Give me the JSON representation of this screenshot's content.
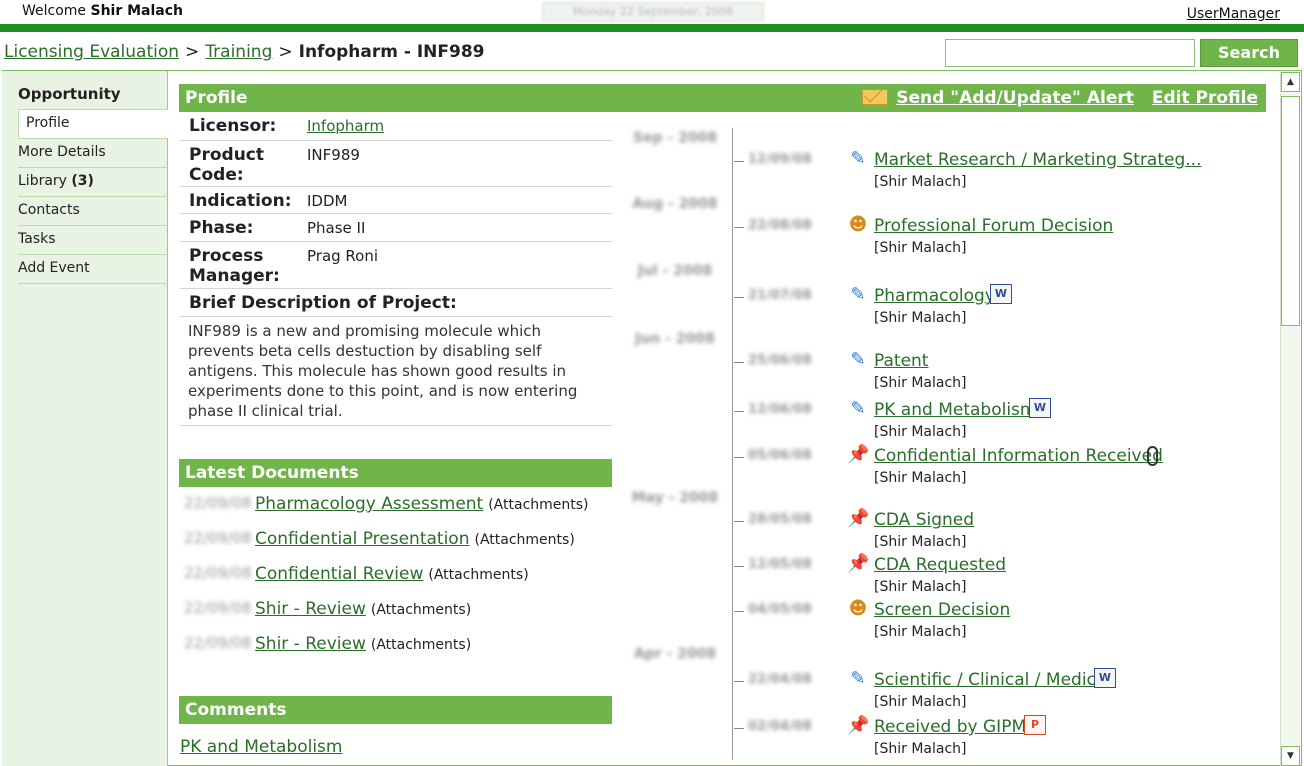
{
  "header": {
    "welcome_prefix": "Welcome",
    "user_name": "Shir Malach",
    "date_text": "Monday 22 September, 2008",
    "user_manager_link": "UserManager"
  },
  "breadcrumb": {
    "items": [
      "Licensing Evaluation",
      "Training"
    ],
    "separator": ">",
    "current": "Infopharm - INF989"
  },
  "search": {
    "value": "",
    "button_label": "Search"
  },
  "sidebar": {
    "heading": "Opportunity",
    "items": [
      {
        "label": "Profile",
        "count": ""
      },
      {
        "label": "More Details",
        "count": ""
      },
      {
        "label": "Library",
        "count": "(3)"
      },
      {
        "label": "Contacts",
        "count": ""
      },
      {
        "label": "Tasks",
        "count": ""
      },
      {
        "label": "Add Event",
        "count": ""
      }
    ]
  },
  "profile": {
    "title": "Profile",
    "send_alert_label": "Send \"Add/Update\" Alert",
    "edit_label": "Edit Profile",
    "fields": [
      {
        "label": "Licensor:",
        "value": "Infopharm"
      },
      {
        "label": "Product Code:",
        "value": "INF989"
      },
      {
        "label": "Indication:",
        "value": "IDDM"
      },
      {
        "label": "Phase:",
        "value": "Phase II"
      },
      {
        "label": "Process Manager:",
        "value": "Prag Roni"
      }
    ],
    "brief_label": "Brief Description of Project:",
    "description": "INF989 is a new and promising molecule which prevents beta cells destuction by disabling self antigens. This molecule has shown good results in experiments done to this point, and is now entering phase II clinical trial."
  },
  "latest_documents": {
    "title": "Latest Documents",
    "items": [
      {
        "date": "22/09/08",
        "title": "Pharmacology Assessment",
        "note": "(Attachments)"
      },
      {
        "date": "22/09/08",
        "title": "Confidential Presentation",
        "note": "(Attachments)"
      },
      {
        "date": "22/09/08",
        "title": "Confidential Review",
        "note": "(Attachments)"
      },
      {
        "date": "22/09/08",
        "title": "Shir - Review",
        "note": "(Attachments)"
      },
      {
        "date": "22/09/08",
        "title": "Shir - Review",
        "note": "(Attachments)"
      }
    ]
  },
  "comments": {
    "title": "Comments",
    "first_link": "PK and Metabolism"
  },
  "timeline": {
    "months": [
      "Sep - 2008",
      "Aug - 2008",
      "Jul - 2008",
      "Jun - 2008",
      "May - 2008",
      "Apr - 2008"
    ],
    "events": [
      {
        "date": "12/09/08",
        "icon": "pencil-icon",
        "title": "Market Research / Marketing Strateg...",
        "author": "[Shir Malach]",
        "attachment": ""
      },
      {
        "date": "22/08/08",
        "icon": "people-icon",
        "title": "Professional Forum Decision",
        "author": "[Shir Malach]",
        "attachment": ""
      },
      {
        "date": "21/07/08",
        "icon": "pencil-icon",
        "title": "Pharmacology",
        "author": "[Shir Malach]",
        "attachment": "word-doc-icon"
      },
      {
        "date": "25/06/08",
        "icon": "pencil-icon",
        "title": "Patent",
        "author": "[Shir Malach]",
        "attachment": ""
      },
      {
        "date": "12/06/08",
        "icon": "pencil-icon",
        "title": "PK and Metabolism",
        "author": "[Shir Malach]",
        "attachment": "word-doc-icon"
      },
      {
        "date": "05/06/08",
        "icon": "pin-icon",
        "title": "Confidential Information Received",
        "author": "[Shir Malach]",
        "attachment": "paperclip-icon"
      },
      {
        "date": "28/05/08",
        "icon": "pin-icon",
        "title": "CDA Signed",
        "author": "[Shir Malach]",
        "attachment": ""
      },
      {
        "date": "12/05/08",
        "icon": "pin-icon",
        "title": "CDA Requested",
        "author": "[Shir Malach]",
        "attachment": ""
      },
      {
        "date": "04/05/08",
        "icon": "people-icon",
        "title": "Screen Decision",
        "author": "[Shir Malach]",
        "attachment": ""
      },
      {
        "date": "22/04/08",
        "icon": "pencil-icon",
        "title": "Scientific / Clinical / Medical",
        "author": "[Shir Malach]",
        "attachment": "word-doc-icon"
      },
      {
        "date": "02/04/08",
        "icon": "pin-icon",
        "title": "Received by GIPM",
        "author": "[Shir Malach]",
        "attachment": "ppt-doc-icon"
      }
    ]
  }
}
